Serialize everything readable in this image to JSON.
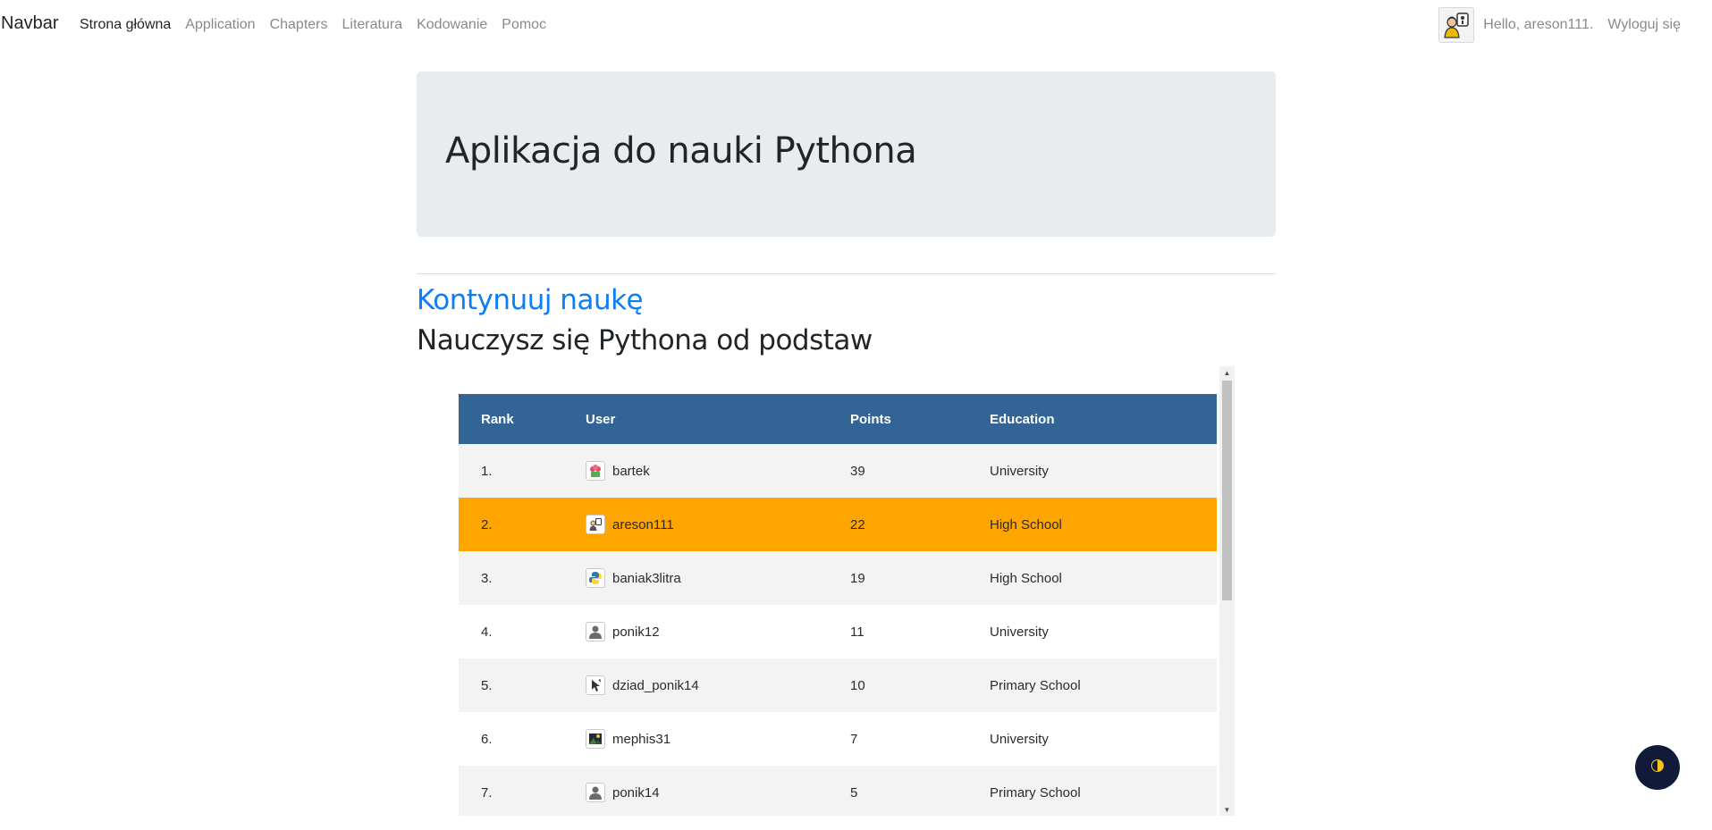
{
  "navbar": {
    "brand": "Navbar",
    "links": [
      {
        "label": "Strona główna",
        "active": true
      },
      {
        "label": "Application",
        "active": false
      },
      {
        "label": "Chapters",
        "active": false
      },
      {
        "label": "Literatura",
        "active": false
      },
      {
        "label": "Kodowanie",
        "active": false
      },
      {
        "label": "Pomoc",
        "active": false
      }
    ],
    "hello": "Hello, areson111.",
    "logout": "Wyloguj się",
    "avatar_icon": "user-avatar-icon"
  },
  "jumbotron": {
    "title": "Aplikacja do nauki Pythona"
  },
  "main": {
    "continue_link": "Kontynuuj naukę",
    "subheading": "Nauczysz się Pythona od podstaw"
  },
  "leaderboard": {
    "headers": {
      "rank": "Rank",
      "user": "User",
      "points": "Points",
      "education": "Education"
    },
    "rows": [
      {
        "rank": "1.",
        "user": "bartek",
        "points": "39",
        "education": "University",
        "icon": "flower-icon"
      },
      {
        "rank": "2.",
        "user": "areson111",
        "points": "22",
        "education": "High School",
        "icon": "user-avatar-icon"
      },
      {
        "rank": "3.",
        "user": "baniak3litra",
        "points": "19",
        "education": "High School",
        "icon": "python-icon"
      },
      {
        "rank": "4.",
        "user": "ponik12",
        "points": "11",
        "education": "University",
        "icon": "default-user-icon"
      },
      {
        "rank": "5.",
        "user": "dziad_ponik14",
        "points": "10",
        "education": "Primary School",
        "icon": "pointer-icon"
      },
      {
        "rank": "6.",
        "user": "mephis31",
        "points": "7",
        "education": "University",
        "icon": "landscape-icon"
      },
      {
        "rank": "7.",
        "user": "ponik14",
        "points": "5",
        "education": "Primary School",
        "icon": "default-user-icon"
      }
    ]
  },
  "colors": {
    "table_header": "#326496",
    "current_user_row": "#ffa500",
    "link": "#0d7ef5",
    "theme_button": "#121a3a"
  },
  "theme_toggle_icon": "half-circle-theme-icon"
}
